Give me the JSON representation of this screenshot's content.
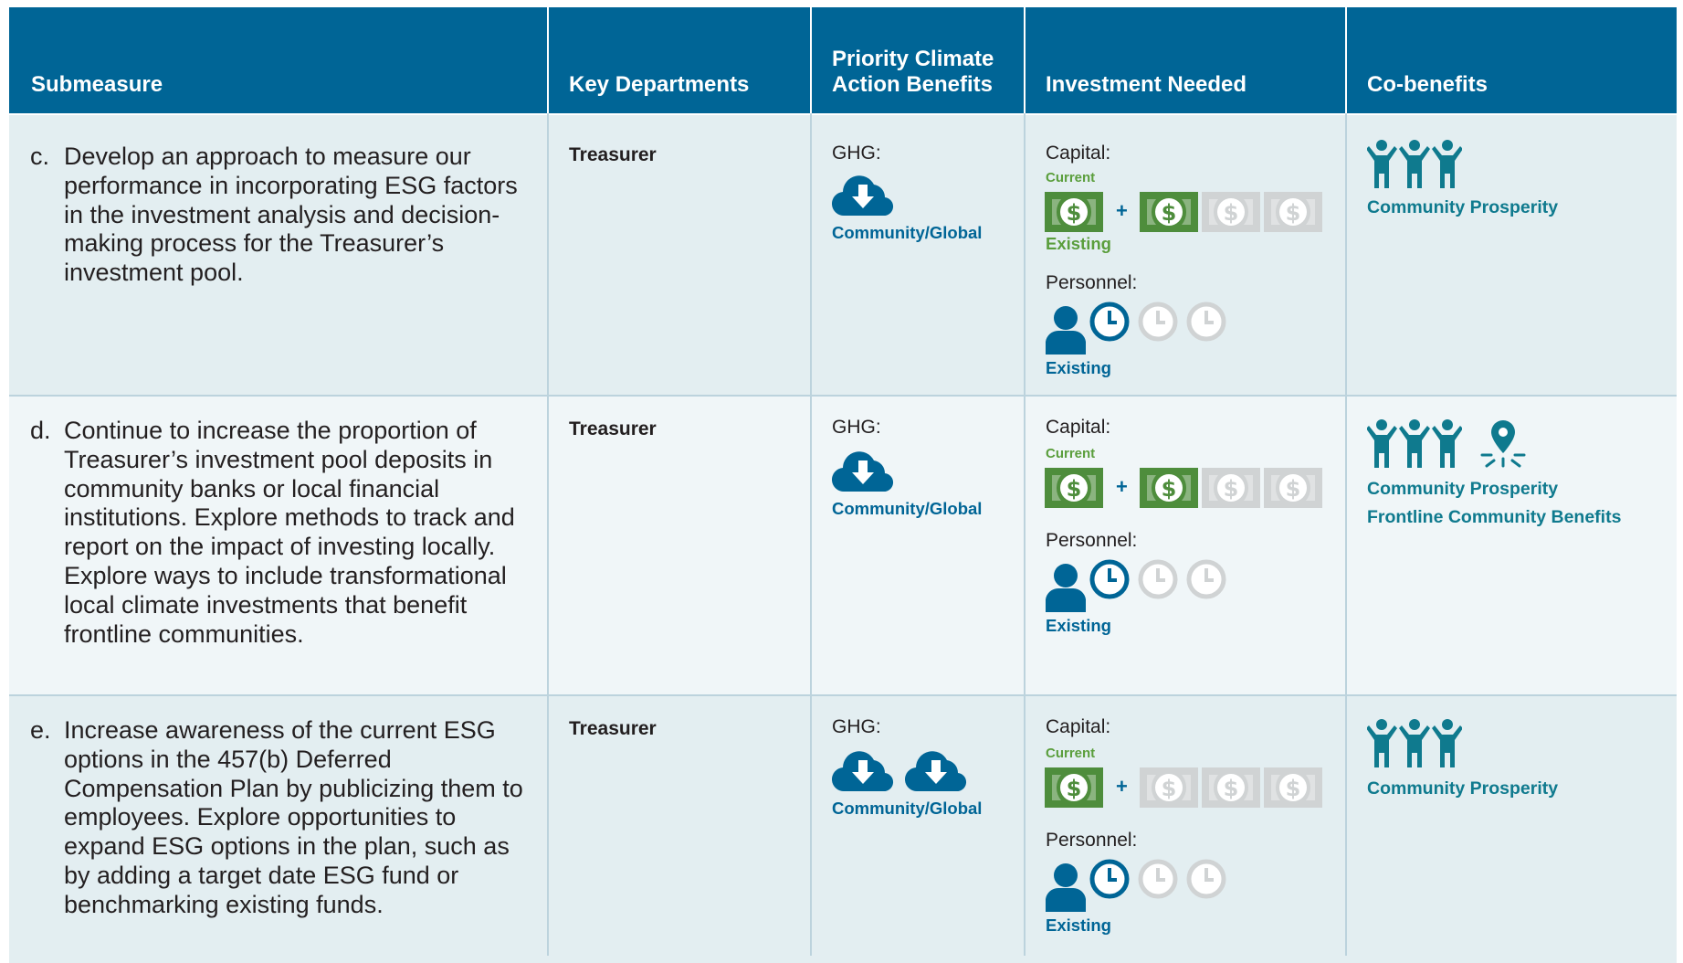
{
  "header": {
    "submeasure": "Submeasure",
    "key_departments": "Key Departments",
    "priority": "Priority Climate Action Benefits",
    "investment": "Investment Needed",
    "cobenefits": "Co-benefits"
  },
  "labels": {
    "ghg": "GHG:",
    "capital": "Capital:",
    "current": "Current",
    "existing": "Existing",
    "personnel": "Personnel:",
    "community_global": "Community/Global",
    "plus": "+"
  },
  "colors": {
    "header_bg": "#006596",
    "row_a": "#e3eef1",
    "row_b": "#f0f6f8",
    "money_active": "#4e8d3c",
    "money_inactive": "#d0d3d4",
    "icon_blue": "#006596",
    "icon_teal": "#0f7a8e"
  },
  "rows": [
    {
      "letter": "c.",
      "text": "Develop an approach to measure our performance in incorporating ESG factors in the investment analysis and decision-making process for the Treasurer’s investment pool.",
      "department": "Treasurer",
      "ghg_clouds": 1,
      "capital_existing_filled": 1,
      "capital_additional_filled": 1,
      "capital_additional_total": 3,
      "personnel_filled": 1,
      "personnel_total": 3,
      "cobenefits": [
        "Community Prosperity"
      ],
      "cobenefit_icons": [
        "people-icon"
      ]
    },
    {
      "letter": "d.",
      "text": "Continue to increase the proportion of Treasurer’s investment pool deposits in community banks or local financial institutions. Explore methods to track and report on the impact of investing locally. Explore ways to include transformational local climate investments that benefit frontline communities.",
      "department": "Treasurer",
      "ghg_clouds": 1,
      "capital_existing_filled": 1,
      "capital_additional_filled": 1,
      "capital_additional_total": 3,
      "personnel_filled": 1,
      "personnel_total": 3,
      "cobenefits": [
        "Community Prosperity",
        "Frontline Community Benefits"
      ],
      "cobenefit_icons": [
        "people-icon",
        "location-pin-icon"
      ]
    },
    {
      "letter": "e.",
      "text": "Increase awareness of the current ESG options in the 457(b) Deferred Compensation Plan by publicizing them to employees. Explore opportunities to expand ESG options in the plan, such as by adding a target date ESG fund or benchmarking existing funds.",
      "department": "Treasurer",
      "ghg_clouds": 2,
      "capital_existing_filled": 1,
      "capital_additional_filled": 0,
      "capital_additional_total": 3,
      "personnel_filled": 1,
      "personnel_total": 3,
      "cobenefits": [
        "Community Prosperity"
      ],
      "cobenefit_icons": [
        "people-icon"
      ]
    }
  ]
}
